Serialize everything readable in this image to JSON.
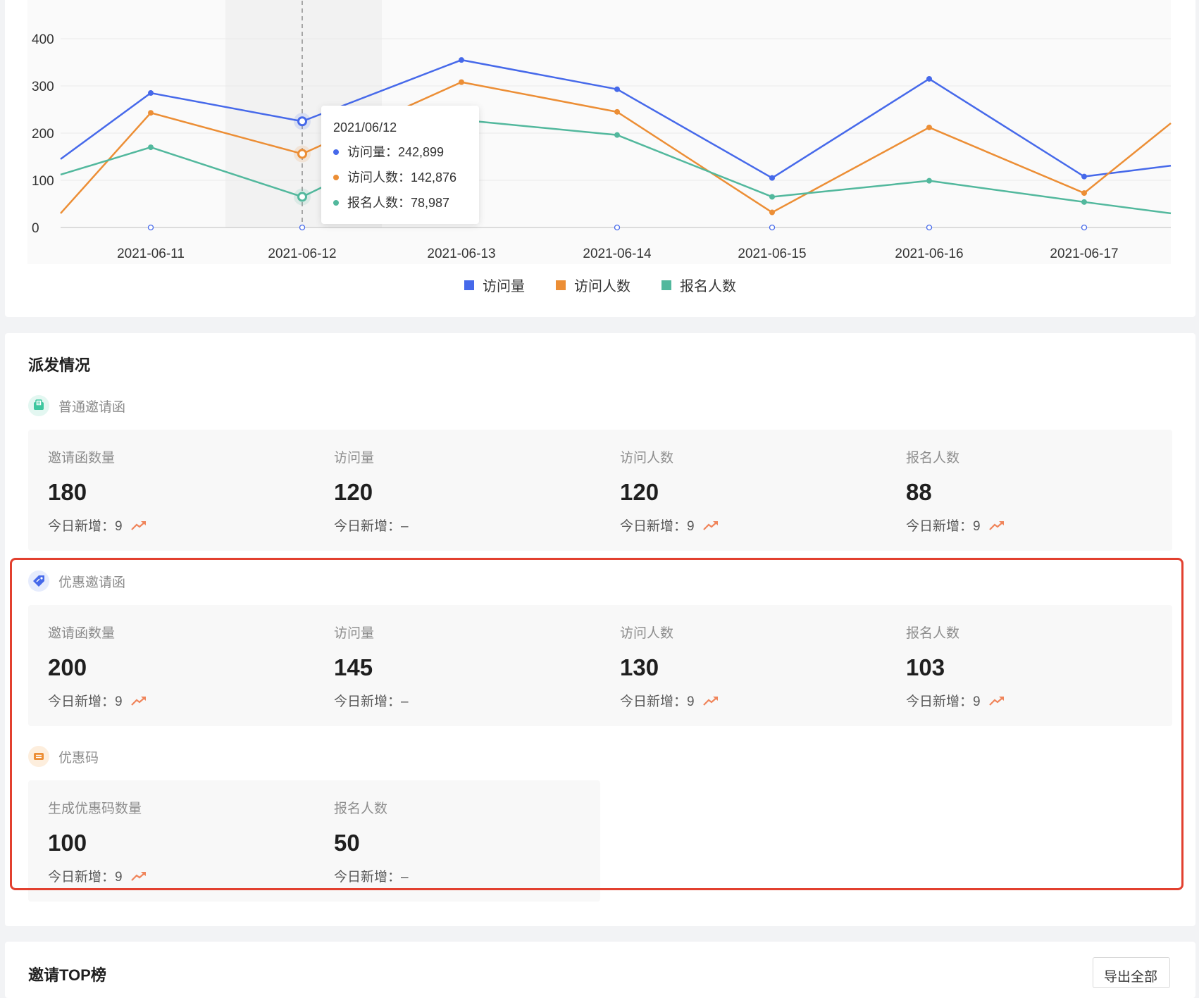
{
  "chart_data": {
    "type": "line",
    "categories": [
      "2021-06-11",
      "2021-06-12",
      "2021-06-13",
      "2021-06-14",
      "2021-06-15",
      "2021-06-16",
      "2021-06-17"
    ],
    "y_ticks": [
      "0",
      "100",
      "200",
      "300",
      "400"
    ],
    "ylim": [
      0,
      400
    ],
    "grid": true,
    "legend": "bottom-center",
    "series": [
      {
        "name": "访问量",
        "color": "#4669ea",
        "start": 145,
        "values": [
          285,
          225,
          355,
          293,
          105,
          315,
          108
        ],
        "end": 131
      },
      {
        "name": "访问人数",
        "color": "#ec8e35",
        "start": 30,
        "values": [
          243,
          156,
          308,
          245,
          32,
          212,
          73
        ],
        "end": 221
      },
      {
        "name": "报名人数",
        "color": "#52b89d",
        "start": 112,
        "values": [
          170,
          65,
          228,
          196,
          65,
          99,
          54
        ],
        "end": 30
      }
    ],
    "highlight_category": "2021-06-12",
    "tooltip": {
      "title": "2021/06/12",
      "rows": [
        {
          "label": "访问量：242,899",
          "color": "#4669ea"
        },
        {
          "label": "访问人数：142,876",
          "color": "#ec8e35"
        },
        {
          "label": "报名人数：78,987",
          "color": "#52b89d"
        }
      ]
    }
  },
  "distribution": {
    "title": "派发情况",
    "groups": [
      {
        "name": "普通邀请函",
        "icon": "invitation-icon",
        "stats": [
          {
            "label": "邀请函数量",
            "value": "180",
            "today": "今日新增：9",
            "trend": true
          },
          {
            "label": "访问量",
            "value": "120",
            "today": "今日新增：–",
            "trend": false
          },
          {
            "label": "访问人数",
            "value": "120",
            "today": "今日新增：9",
            "trend": true
          },
          {
            "label": "报名人数",
            "value": "88",
            "today": "今日新增：9",
            "trend": true
          }
        ]
      },
      {
        "name": "优惠邀请函",
        "icon": "discount-tag-icon",
        "stats": [
          {
            "label": "邀请函数量",
            "value": "200",
            "today": "今日新增：9",
            "trend": true
          },
          {
            "label": "访问量",
            "value": "145",
            "today": "今日新增：–",
            "trend": false
          },
          {
            "label": "访问人数",
            "value": "130",
            "today": "今日新增：9",
            "trend": true
          },
          {
            "label": "报名人数",
            "value": "103",
            "today": "今日新增：9",
            "trend": true
          }
        ]
      },
      {
        "name": "优惠码",
        "icon": "coupon-icon",
        "stats": [
          {
            "label": "生成优惠码数量",
            "value": "100",
            "today": "今日新增：9",
            "trend": true
          },
          {
            "label": "报名人数",
            "value": "50",
            "today": "今日新增：–",
            "trend": false
          }
        ]
      }
    ]
  },
  "top_list": {
    "title": "邀请TOP榜",
    "export_label": "导出全部"
  }
}
